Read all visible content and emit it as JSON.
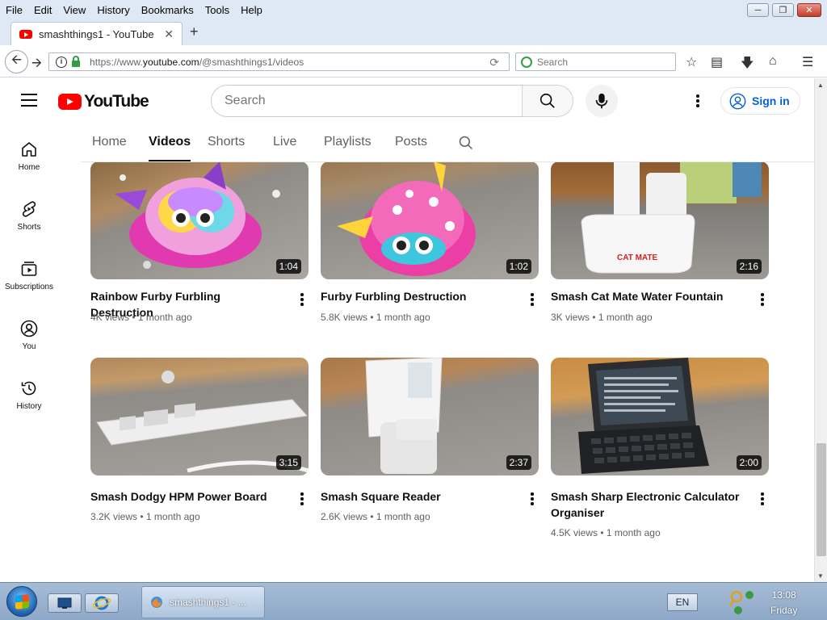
{
  "browser": {
    "menu": [
      "File",
      "Edit",
      "View",
      "History",
      "Bookmarks",
      "Tools",
      "Help"
    ],
    "tab_title": "smashthings1 - YouTube",
    "url_prefix": "https://www.",
    "url_domain": "youtube.com",
    "url_path": "/@smashthings1/videos",
    "search_placeholder": "Search"
  },
  "youtube": {
    "logo_text": "YouTube",
    "search_placeholder": "Search",
    "signin_label": "Sign in",
    "sidebar": [
      {
        "label": "Home",
        "icon": "home-icon"
      },
      {
        "label": "Shorts",
        "icon": "shorts-icon"
      },
      {
        "label": "Subscriptions",
        "icon": "subscriptions-icon"
      },
      {
        "label": "You",
        "icon": "you-icon"
      },
      {
        "label": "History",
        "icon": "history-icon"
      }
    ],
    "tabs": [
      "Home",
      "Videos",
      "Shorts",
      "Live",
      "Playlists",
      "Posts"
    ],
    "active_tab": "Videos",
    "videos": [
      {
        "title": "Rainbow Furby Furbling Destruction",
        "duration": "1:04",
        "views": "4K views",
        "age": "1 month ago"
      },
      {
        "title": "Furby Furbling Destruction",
        "duration": "1:02",
        "views": "5.8K views",
        "age": "1 month ago"
      },
      {
        "title": "Smash Cat Mate Water Fountain",
        "duration": "2:16",
        "views": "3K views",
        "age": "1 month ago"
      },
      {
        "title": "Smash Dodgy HPM Power Board",
        "duration": "3:15",
        "views": "3.2K views",
        "age": "1 month ago"
      },
      {
        "title": "Smash Square Reader",
        "duration": "2:37",
        "views": "2.6K views",
        "age": "1 month ago"
      },
      {
        "title": "Smash Sharp Electronic Calculator Organiser",
        "duration": "2:00",
        "views": "4.5K views",
        "age": "1 month ago"
      }
    ],
    "thumb_text": {
      "cat_mate": "CAT MATE"
    }
  },
  "taskbar": {
    "task_label": "smashthings1 - ...",
    "language": "EN",
    "time": "13:08",
    "day": "Friday"
  },
  "colors": {
    "youtube_red": "#ff0000",
    "link_blue": "#065fd4"
  }
}
